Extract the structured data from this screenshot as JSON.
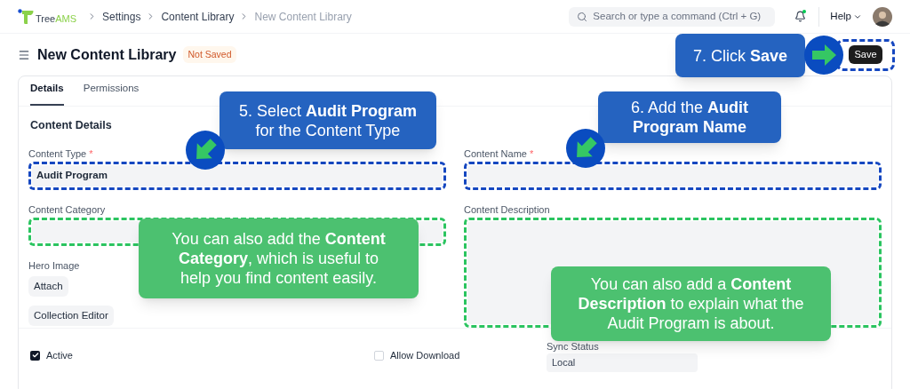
{
  "brand": [
    "Tree",
    "AMS"
  ],
  "breadcrumbs": [
    {
      "label": "Settings",
      "current": false
    },
    {
      "label": "Content Library",
      "current": false
    },
    {
      "label": "New Content Library",
      "current": true
    }
  ],
  "search": {
    "placeholder": "Search or type a command (Ctrl + G)"
  },
  "notifications": {
    "unread": true
  },
  "help": "Help",
  "page": {
    "title": "New Content Library",
    "status": "Not Saved",
    "save": "Save"
  },
  "tabs": [
    {
      "label": "Details",
      "selected": true
    },
    {
      "label": "Permissions",
      "selected": false
    }
  ],
  "section": "Content Details",
  "left_fields": [
    {
      "kind": "input",
      "label": "Content Type",
      "required_mark": "*",
      "value": "Audit Program",
      "color": "#1547c0"
    },
    {
      "kind": "input",
      "label": "Content Category",
      "color": "#2bc460"
    },
    {
      "kind": "buttons",
      "label": "Hero Image",
      "buttons": [
        "Attach",
        "Collection Editor"
      ]
    }
  ],
  "right_fields": [
    {
      "kind": "input",
      "label": "Content Name",
      "required_mark": "*",
      "color": "#1547c0"
    },
    {
      "kind": "textarea",
      "label": "Content Description",
      "color": "#2bc460"
    }
  ],
  "bottom": [
    {
      "kind": "checkbox",
      "label": "Active",
      "checked": true
    },
    {
      "kind": "checkbox",
      "label": "Allow Download",
      "checked": false
    },
    {
      "kind": "select",
      "label": "Sync Status",
      "value": "Local"
    }
  ],
  "callouts": [
    {
      "kind": "step",
      "text": "7. Click **Save**"
    },
    {
      "kind": "step",
      "text": "5. Select **Audit Program**\nfor the Content Type"
    },
    {
      "kind": "step",
      "text": "6. Add the **Audit\nProgram Name**"
    },
    {
      "kind": "tip",
      "text": "You can also add the **Content\nCategory**, which is useful to\nhelp you find content easily."
    },
    {
      "kind": "tip",
      "text": "You can also add a **Content\nDescription** to explain what the\nAudit Program is about."
    }
  ]
}
